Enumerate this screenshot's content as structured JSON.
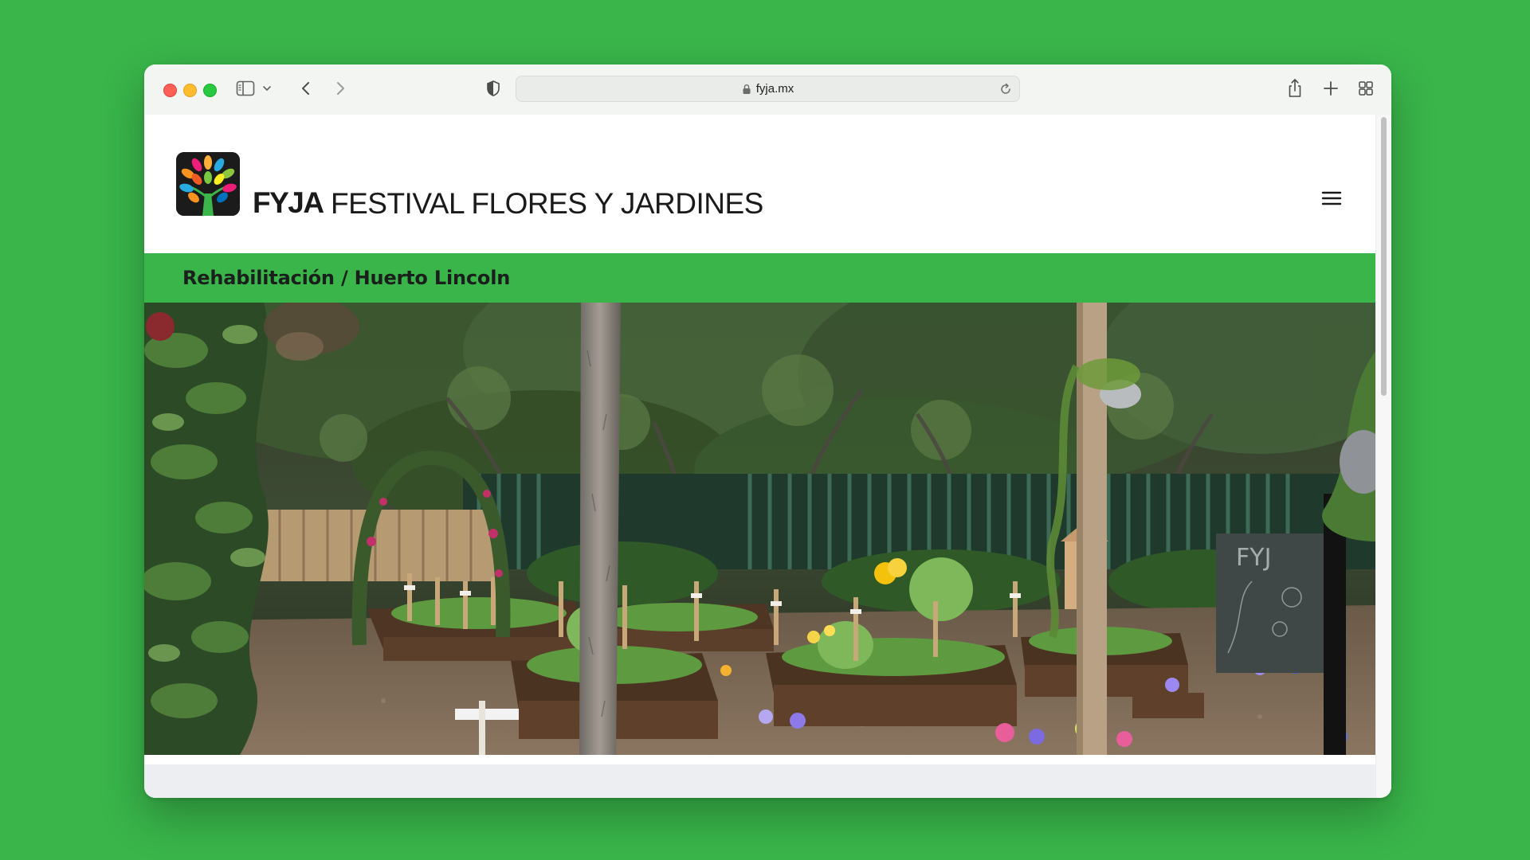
{
  "browser": {
    "url": "fyja.mx",
    "icons": {
      "sidebar": "sidebar-icon",
      "back": "chevron-left-icon",
      "forward": "chevron-right-icon",
      "privacy": "shield-icon",
      "lock": "lock-icon",
      "reload": "reload-icon",
      "share": "share-icon",
      "new_tab": "plus-icon",
      "tab_overview": "grid-icon"
    }
  },
  "site": {
    "brand_short": "FYJA",
    "brand_full": "FESTIVAL FLORES Y JARDINES",
    "breadcrumb": "Rehabilitación / Huerto Lincoln",
    "hero_sign_text": "FYJ",
    "colors": {
      "accent_green": "#39b54a",
      "text_dark": "#1a1a1a"
    }
  }
}
